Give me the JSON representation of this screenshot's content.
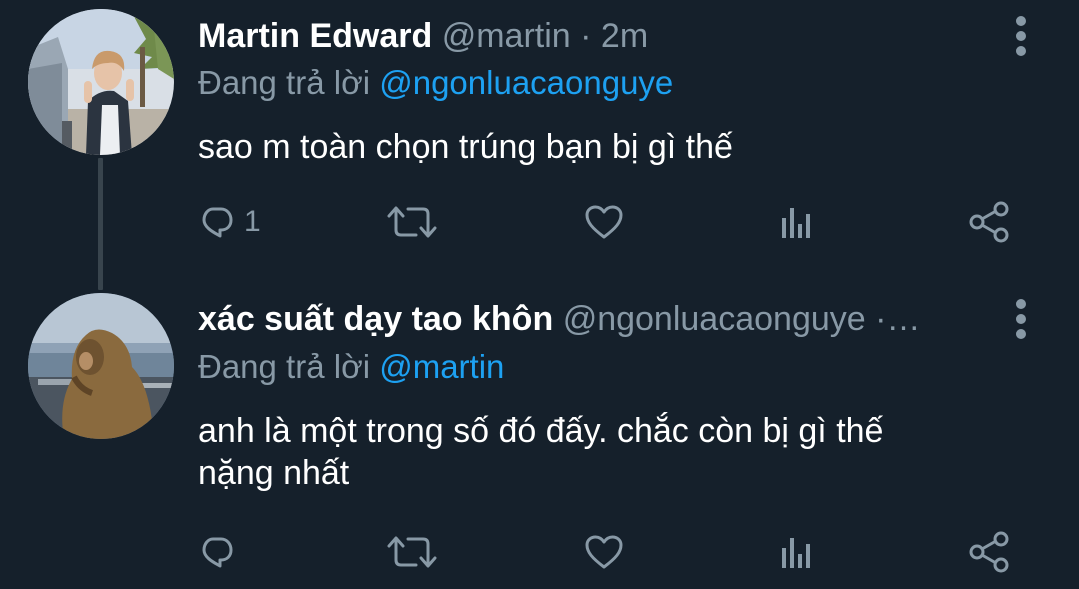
{
  "tweets": [
    {
      "name": "Martin Edward",
      "handle": "@martin",
      "separator": "·",
      "time": "2m",
      "reply_prefix": "Đang trả lời",
      "reply_to": "@ngonluacaonguye",
      "text": "sao m toàn chọn trúng bạn bị gì thế",
      "actions": {
        "reply_count": "1"
      }
    },
    {
      "name": "xác suất dạy tao khôn",
      "handle": "@ngonluacaonguye",
      "separator": "·",
      "truncation": "…",
      "reply_prefix": "Đang trả lời",
      "reply_to": "@martin",
      "text_line_1": "anh là một trong số đó đấy. chắc còn bị gì thế",
      "text_line_2": "nặng nhất"
    }
  ],
  "icons": {
    "reply": "reply-icon",
    "retweet": "retweet-icon",
    "like": "heart-icon",
    "analytics": "analytics-icon",
    "share": "share-icon",
    "more": "more-vertical-icon"
  },
  "colors": {
    "background": "#15202b",
    "primary_text": "#ffffff",
    "secondary_text": "#8899a6",
    "link": "#1da1f2",
    "thread_line": "#38444d"
  }
}
